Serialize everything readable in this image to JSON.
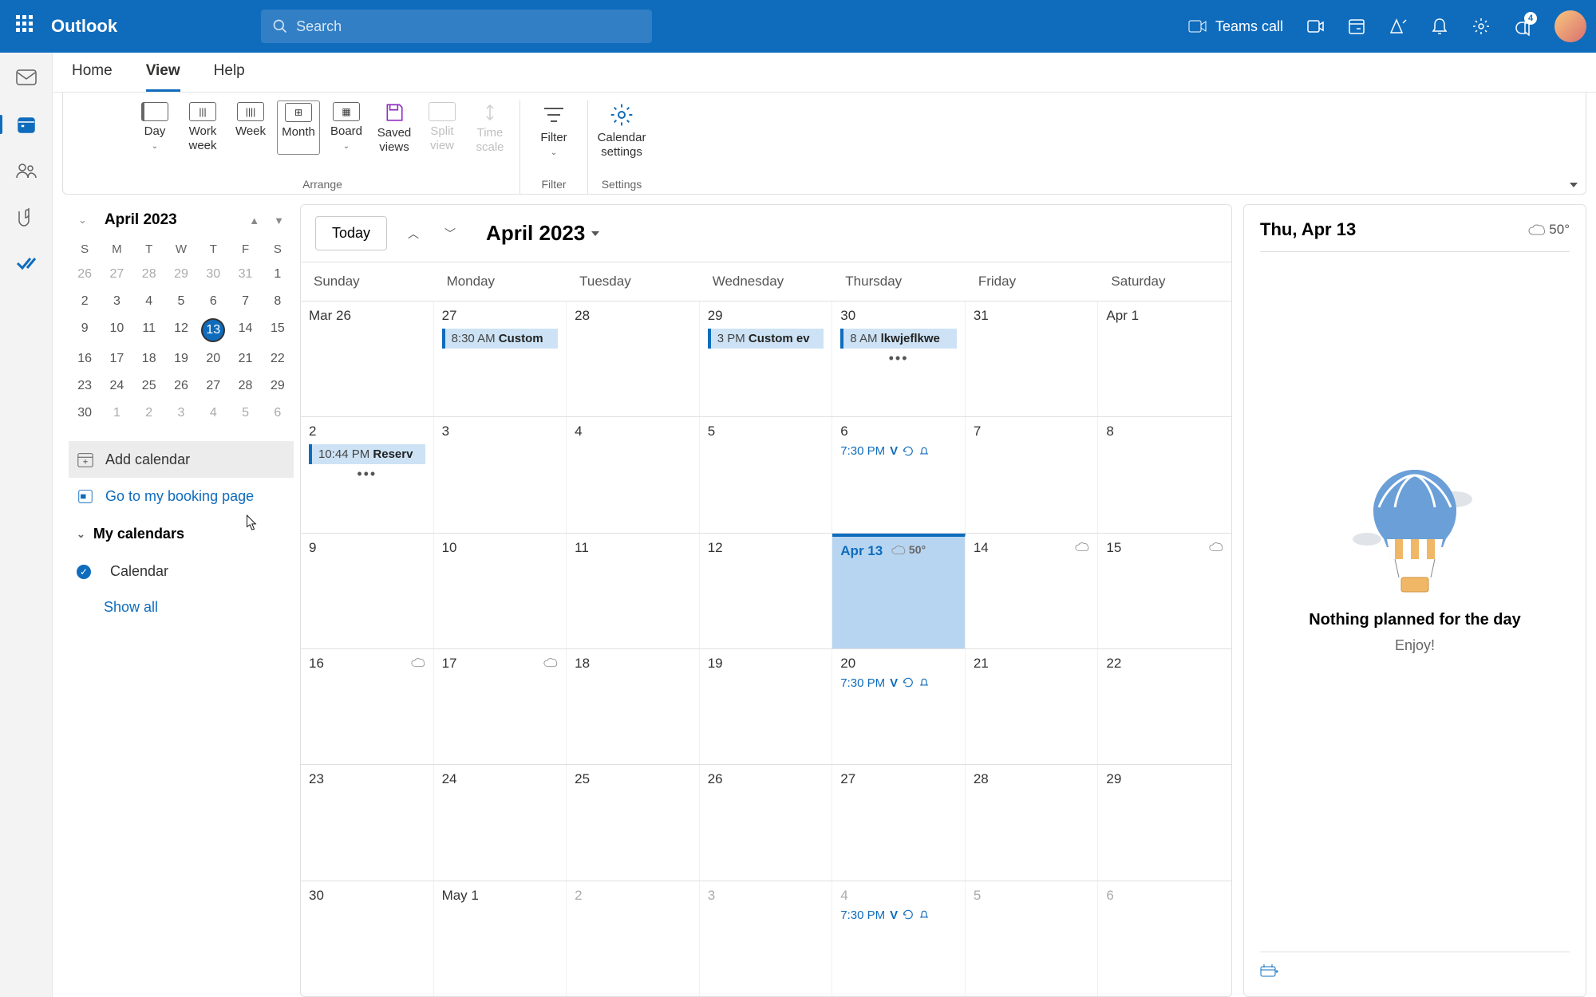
{
  "header": {
    "brand": "Outlook",
    "search_placeholder": "Search",
    "teams_call": "Teams call",
    "tips_badge": "4"
  },
  "tabs": {
    "home": "Home",
    "view": "View",
    "help": "Help"
  },
  "ribbon": {
    "day": "Day",
    "work_week": "Work week",
    "week": "Week",
    "month": "Month",
    "board": "Board",
    "saved_views": "Saved views",
    "split_view": "Split view",
    "time_scale": "Time scale",
    "filter": "Filter",
    "calendar_settings": "Calendar settings",
    "group_arrange": "Arrange",
    "group_filter": "Filter",
    "group_settings": "Settings"
  },
  "sidebar": {
    "mini_title": "April 2023",
    "dow": [
      "S",
      "M",
      "T",
      "W",
      "T",
      "F",
      "S"
    ],
    "mini_days": [
      {
        "n": "26",
        "d": true
      },
      {
        "n": "27",
        "d": true
      },
      {
        "n": "28",
        "d": true
      },
      {
        "n": "29",
        "d": true
      },
      {
        "n": "30",
        "d": true
      },
      {
        "n": "31",
        "d": true
      },
      {
        "n": "1"
      },
      {
        "n": "2"
      },
      {
        "n": "3"
      },
      {
        "n": "4"
      },
      {
        "n": "5"
      },
      {
        "n": "6"
      },
      {
        "n": "7"
      },
      {
        "n": "8"
      },
      {
        "n": "9"
      },
      {
        "n": "10"
      },
      {
        "n": "11"
      },
      {
        "n": "12"
      },
      {
        "n": "13",
        "t": true
      },
      {
        "n": "14"
      },
      {
        "n": "15"
      },
      {
        "n": "16"
      },
      {
        "n": "17"
      },
      {
        "n": "18"
      },
      {
        "n": "19"
      },
      {
        "n": "20"
      },
      {
        "n": "21"
      },
      {
        "n": "22"
      },
      {
        "n": "23"
      },
      {
        "n": "24"
      },
      {
        "n": "25"
      },
      {
        "n": "26"
      },
      {
        "n": "27"
      },
      {
        "n": "28"
      },
      {
        "n": "29"
      },
      {
        "n": "30"
      },
      {
        "n": "1",
        "d": true
      },
      {
        "n": "2",
        "d": true
      },
      {
        "n": "3",
        "d": true
      },
      {
        "n": "4",
        "d": true
      },
      {
        "n": "5",
        "d": true
      },
      {
        "n": "6",
        "d": true
      }
    ],
    "add_calendar": "Add calendar",
    "booking_page": "Go to my booking page",
    "my_calendars": "My calendars",
    "calendar_item": "Calendar",
    "show_all": "Show all"
  },
  "calendar": {
    "today_btn": "Today",
    "title": "April 2023",
    "dow": [
      "Sunday",
      "Monday",
      "Tuesday",
      "Wednesday",
      "Thursday",
      "Friday",
      "Saturday"
    ],
    "weeks": [
      [
        {
          "label": "Mar 26"
        },
        {
          "label": "27",
          "event_pill": {
            "time": "8:30 AM",
            "title": "Custom"
          }
        },
        {
          "label": "28"
        },
        {
          "label": "29",
          "event_pill": {
            "time": "3 PM",
            "title": "Custom ev"
          }
        },
        {
          "label": "30",
          "event_pill": {
            "time": "8 AM",
            "title": "lkwjeflkwe"
          },
          "more": true
        },
        {
          "label": "31"
        },
        {
          "label": "Apr 1"
        }
      ],
      [
        {
          "label": "2",
          "event_pill": {
            "time": "10:44 PM",
            "title": "Reserv"
          },
          "more": true
        },
        {
          "label": "3"
        },
        {
          "label": "4"
        },
        {
          "label": "5"
        },
        {
          "label": "6",
          "event_text": {
            "time": "7:30 PM",
            "title": "V",
            "recur": true,
            "bell": true
          }
        },
        {
          "label": "7"
        },
        {
          "label": "8"
        }
      ],
      [
        {
          "label": "9"
        },
        {
          "label": "10"
        },
        {
          "label": "11"
        },
        {
          "label": "12"
        },
        {
          "label": "Apr 13",
          "today": true,
          "weather": "50°"
        },
        {
          "label": "14",
          "weather_icon": true
        },
        {
          "label": "15",
          "weather_icon": true
        }
      ],
      [
        {
          "label": "16",
          "weather_icon": true
        },
        {
          "label": "17",
          "weather_icon": true
        },
        {
          "label": "18"
        },
        {
          "label": "19"
        },
        {
          "label": "20",
          "event_text": {
            "time": "7:30 PM",
            "title": "V",
            "recur": true,
            "bell": true
          }
        },
        {
          "label": "21"
        },
        {
          "label": "22"
        }
      ],
      [
        {
          "label": "23"
        },
        {
          "label": "24"
        },
        {
          "label": "25"
        },
        {
          "label": "26"
        },
        {
          "label": "27"
        },
        {
          "label": "28"
        },
        {
          "label": "29"
        }
      ],
      [
        {
          "label": "30"
        },
        {
          "label": "May 1"
        },
        {
          "label": "2",
          "dim": true
        },
        {
          "label": "3",
          "dim": true
        },
        {
          "label": "4",
          "dim": true,
          "event_text": {
            "time": "7:30 PM",
            "title": "V",
            "recur": true,
            "bell": true
          }
        },
        {
          "label": "5",
          "dim": true
        },
        {
          "label": "6",
          "dim": true
        }
      ]
    ]
  },
  "right_pane": {
    "date": "Thu, Apr 13",
    "temp": "50°",
    "message": "Nothing planned for the day",
    "sub": "Enjoy!"
  }
}
